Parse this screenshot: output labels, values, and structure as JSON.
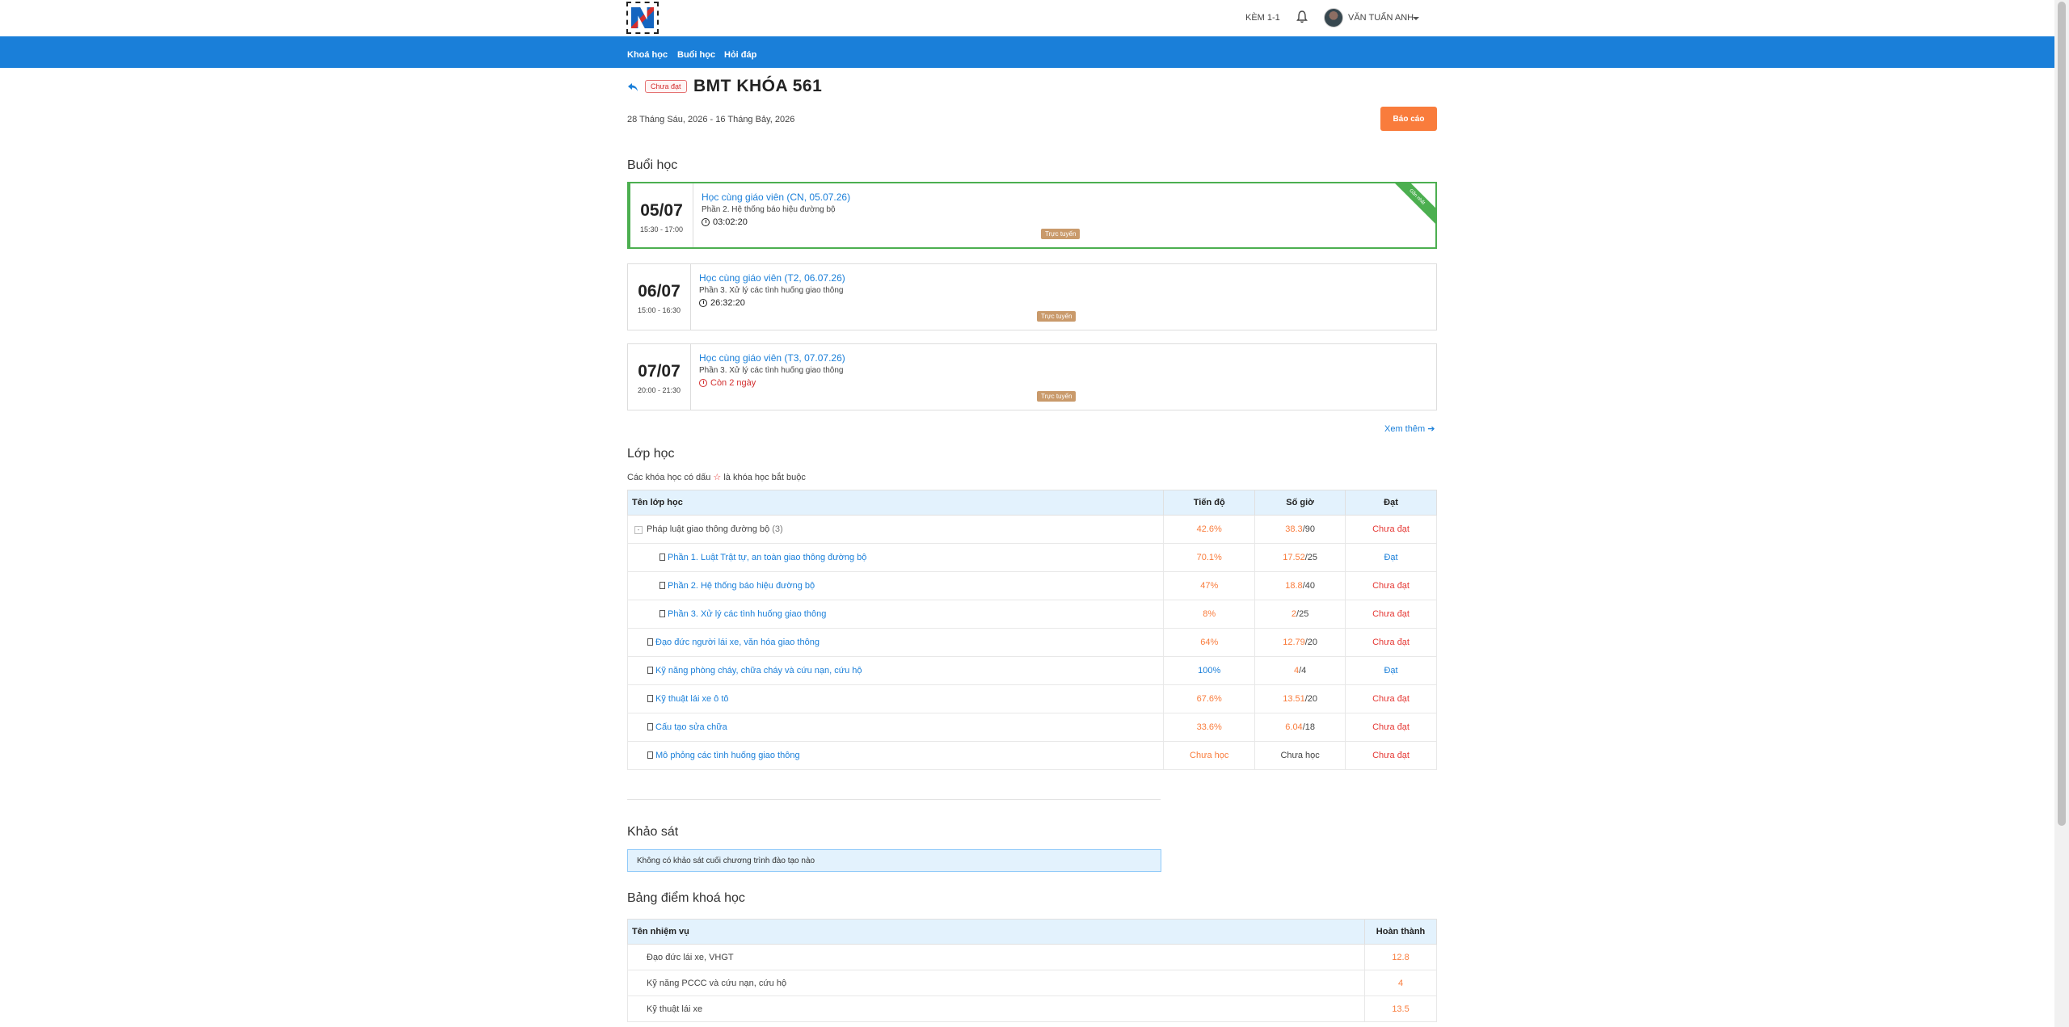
{
  "header": {
    "link_1on1": "KÈM 1-1",
    "username": "VĂN TUẤN ANH"
  },
  "nav": [
    "Khoá học",
    "Buổi học",
    "Hỏi đáp"
  ],
  "course": {
    "status": "Chưa đạt",
    "title": "BMT KHÓA 561",
    "date_range": "28 Tháng Sáu, 2026 - 16 Tháng Bảy, 2026",
    "report_label": "Báo cáo"
  },
  "sessions_section": {
    "title": "Buổi học",
    "see_more": "Xem thêm",
    "items": [
      {
        "day": "05/07",
        "time": "15:30 - 17:00",
        "title": "Học cùng giáo viên (CN, 05.07.26)",
        "subtitle": "Phần 2. Hệ thống báo hiệu đường bộ",
        "timer": "03:02:20",
        "mode": "Trực tuyến",
        "ribbon": "Gần nhất"
      },
      {
        "day": "06/07",
        "time": "15:00 - 16:30",
        "title": "Học cùng giáo viên (T2, 06.07.26)",
        "subtitle": "Phần 3. Xử lý các tình huống giao thông",
        "timer": "26:32:20",
        "mode": "Trực tuyến"
      },
      {
        "day": "07/07",
        "time": "20:00 - 21:30",
        "title": "Học cùng giáo viên (T3, 07.07.26)",
        "subtitle": "Phần 3. Xử lý các tình huống giao thông",
        "timer": "Còn 2 ngày",
        "mode": "Trực tuyến"
      }
    ]
  },
  "classes_section": {
    "title": "Lớp học",
    "note_before": "Các khóa học có dấu",
    "note_star": "☆",
    "note_after": "là khóa học bắt buộc",
    "columns": [
      "Tên lớp học",
      "Tiến độ",
      "Số giờ",
      "Đạt"
    ],
    "rows": [
      {
        "name": "Pháp luật giao thông đường bộ",
        "count": "(3)",
        "progress": "42.6%",
        "hours": "38.3",
        "total": "/90",
        "result": "Chưa đạt"
      },
      {
        "name": "Phần 1. Luật Trật tự, an toàn giao thông đường bộ",
        "progress": "70.1%",
        "hours": "17.52",
        "total": "/25",
        "result": "Đạt"
      },
      {
        "name": "Phần 2. Hệ thống báo hiệu đường bộ",
        "progress": "47%",
        "hours": "18.8",
        "total": "/40",
        "result": "Chưa đạt"
      },
      {
        "name": "Phần 3. Xử lý các tình huống giao thông",
        "progress": "8%",
        "hours": "2",
        "total": "/25",
        "result": "Chưa đạt"
      },
      {
        "name": "Đạo đức người lái xe, văn hóa giao thông",
        "progress": "64%",
        "hours": "12.79",
        "total": "/20",
        "result": "Chưa đạt"
      },
      {
        "name": "Kỹ năng phòng cháy, chữa cháy và cứu nạn, cứu hộ",
        "progress": "100%",
        "hours": "4",
        "total": "/4",
        "result": "Đạt"
      },
      {
        "name": "Kỹ thuật lái xe ô tô",
        "progress": "67.6%",
        "hours": "13.51",
        "total": "/20",
        "result": "Chưa đạt"
      },
      {
        "name": "Cấu tạo sửa chữa",
        "progress": "33.6%",
        "hours": "6.04",
        "total": "/18",
        "result": "Chưa đạt"
      },
      {
        "name": "Mô phỏng các tình huống giao thông",
        "progress": "Chưa học",
        "hours_text": "Chưa học",
        "result": "Chưa đạt"
      }
    ]
  },
  "survey_section": {
    "title": "Khảo sát",
    "empty_text": "Không có khảo sát cuối chương trình đào tạo nào"
  },
  "scores_section": {
    "title": "Bảng điểm khoá học",
    "columns": [
      "Tên nhiệm vụ",
      "Hoàn thành"
    ],
    "rows": [
      {
        "task": "Đạo đức lái xe, VHGT",
        "value": "12.8"
      },
      {
        "task": "Kỹ năng PCCC và cứu nạn, cứu hộ",
        "value": "4"
      },
      {
        "task": "Kỹ thuật lái xe",
        "value": "13.5"
      }
    ]
  },
  "colors": {
    "primary": "#1a7fd9",
    "accent": "#f97c3c",
    "danger": "#e53935",
    "success": "#4caf50"
  }
}
